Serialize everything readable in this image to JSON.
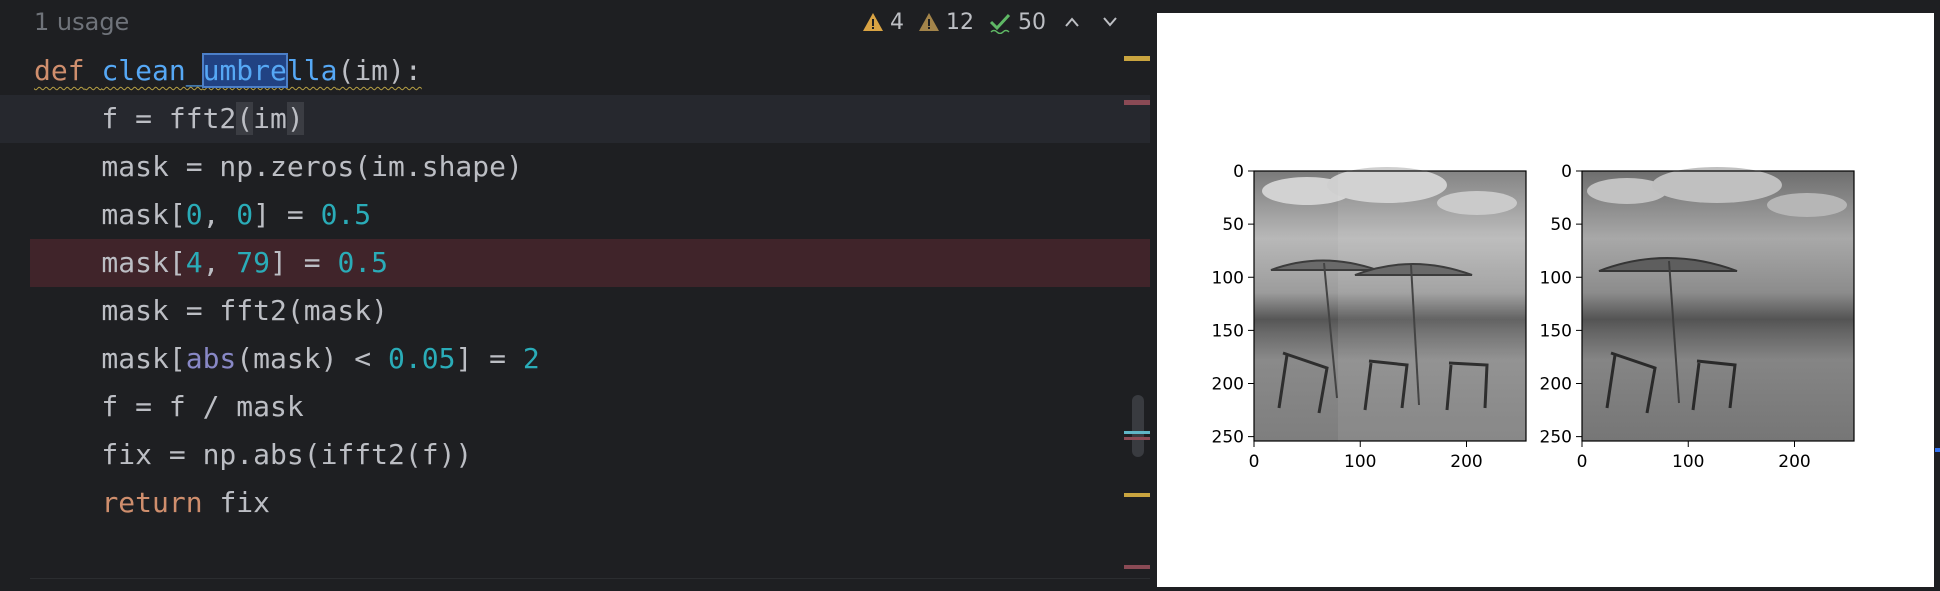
{
  "editor": {
    "usage_hint": "1 usage",
    "inspections": {
      "errors_count": "4",
      "warnings_count": "12",
      "ok_count": "50"
    },
    "lines": [
      [
        "def",
        " ",
        "clean_",
        "umbre",
        "lla",
        "(im):"
      ],
      [
        "    f = fft2",
        "(",
        "im",
        ")"
      ],
      [
        "    mask = np.zeros(im.shape)"
      ],
      [
        "    mask[",
        "0",
        ", ",
        "0",
        "] = ",
        "0.5"
      ],
      [
        "    mask[",
        "4",
        ", ",
        "79",
        "] = ",
        "0.5"
      ],
      [
        "    mask = fft2(mask)"
      ],
      [
        "    mask[",
        "abs",
        "(mask) < ",
        "0.05",
        "] = ",
        "2"
      ],
      [
        "    f = f / mask"
      ],
      [
        "    fix = np.abs(ifft2(f))"
      ],
      [
        "    ",
        "return",
        " fix"
      ]
    ],
    "colors": {
      "keyword": "#cf8e6d",
      "function": "#56a8f5",
      "number": "#2aacb8",
      "builtin": "#8888c6",
      "breakpoint_line": "#40242a"
    }
  },
  "plot": {
    "subplots": [
      {
        "y_ticks": [
          "0",
          "50",
          "100",
          "150",
          "200",
          "250"
        ],
        "x_ticks": [
          "0",
          "100",
          "200"
        ]
      },
      {
        "y_ticks": [
          "0",
          "50",
          "100",
          "150",
          "200",
          "250"
        ],
        "x_ticks": [
          "0",
          "100",
          "200"
        ]
      }
    ]
  }
}
